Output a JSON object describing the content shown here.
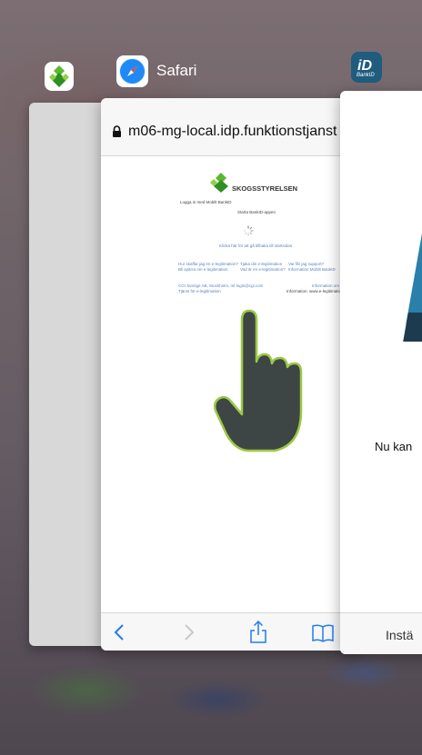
{
  "apps": {
    "safari_title": "Safari",
    "bankid_icon_text": "BankID"
  },
  "safari": {
    "url": "m06-mg-local.idp.funktionstjanst",
    "page": {
      "logo_text": "SKOGSSTYRELSEN",
      "login_heading": "Logga in med Mobilt BankID",
      "start_text": "Starta BankID-appen",
      "return_link": "Klicka här för att gå tillbaka till startsidan",
      "faq_left_1": "Hur skaffar jag en e-legitimation?",
      "faq_left_2": "Bli spärra om e-legitimation",
      "faq_mid_1": "Tjaka din e-legitimation",
      "faq_mid_2": "Vad är en e-legitimation?",
      "faq_right_1": "Var får jag support?",
      "faq_right_2": "Information Mobilt BankID",
      "footer_left_1": "CGI Sverige AB, Stockholm, ml-login@cgi.com",
      "footer_left_2": "Tjänst för e-legitimation",
      "footer_right_1": "Information om kakor",
      "footer_right_2": "Information: www.e-legitimation.se"
    }
  },
  "bankid": {
    "body_text": "Nu kan",
    "bottom_button": "Instä"
  },
  "colors": {
    "safari_blue": "#1f7cf2",
    "bankid_blue": "#2a7fab",
    "bankid_dark": "#1d3b4f",
    "hand_fill": "#3e4545",
    "hand_outline": "#9bc944"
  }
}
